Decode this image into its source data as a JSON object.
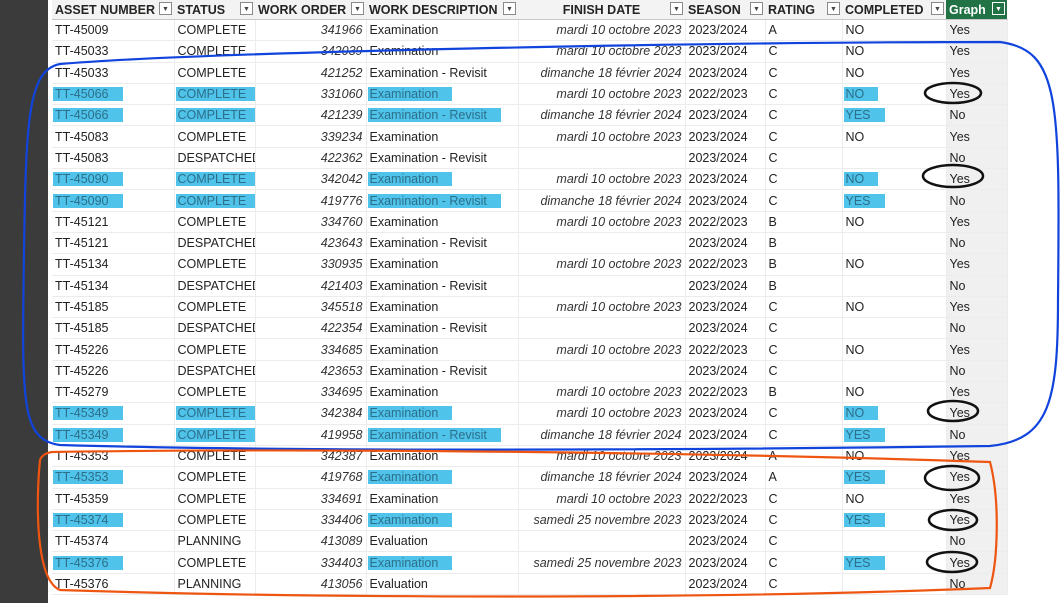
{
  "columns": [
    "ASSET NUMBER",
    "STATUS",
    "WORK ORDER",
    "WORK DESCRIPTION",
    "FINISH DATE",
    "SEASON",
    "RATING",
    "COMPLETED",
    "Graph"
  ],
  "rows": [
    [
      "TT-45009",
      "COMPLETE",
      "341966",
      "Examination",
      "mardi 10 octobre 2023",
      "2023/2024",
      "A",
      "NO",
      "Yes"
    ],
    [
      "TT-45033",
      "COMPLETE",
      "342039",
      "Examination",
      "mardi 10 octobre 2023",
      "2023/2024",
      "C",
      "NO",
      "Yes"
    ],
    [
      "TT-45033",
      "COMPLETE",
      "421252",
      "Examination - Revisit",
      "dimanche 18 février 2024",
      "2023/2024",
      "C",
      "NO",
      "Yes"
    ],
    [
      "TT-45066",
      "COMPLETE",
      "331060",
      "Examination",
      "mardi 10 octobre 2023",
      "2022/2023",
      "C",
      "NO",
      "Yes"
    ],
    [
      "TT-45066",
      "COMPLETE",
      "421239",
      "Examination - Revisit",
      "dimanche 18 février 2024",
      "2023/2024",
      "C",
      "YES",
      "No"
    ],
    [
      "TT-45083",
      "COMPLETE",
      "339234",
      "Examination",
      "mardi 10 octobre 2023",
      "2023/2024",
      "C",
      "NO",
      "Yes"
    ],
    [
      "TT-45083",
      "DESPATCHED",
      "422362",
      "Examination - Revisit",
      "",
      "2023/2024",
      "C",
      "",
      "No"
    ],
    [
      "TT-45090",
      "COMPLETE",
      "342042",
      "Examination",
      "mardi 10 octobre 2023",
      "2023/2024",
      "C",
      "NO",
      "Yes"
    ],
    [
      "TT-45090",
      "COMPLETE",
      "419776",
      "Examination - Revisit",
      "dimanche 18 février 2024",
      "2023/2024",
      "C",
      "YES",
      "No"
    ],
    [
      "TT-45121",
      "COMPLETE",
      "334760",
      "Examination",
      "mardi 10 octobre 2023",
      "2022/2023",
      "B",
      "NO",
      "Yes"
    ],
    [
      "TT-45121",
      "DESPATCHED",
      "423643",
      "Examination - Revisit",
      "",
      "2023/2024",
      "B",
      "",
      "No"
    ],
    [
      "TT-45134",
      "COMPLETE",
      "330935",
      "Examination",
      "mardi 10 octobre 2023",
      "2022/2023",
      "B",
      "NO",
      "Yes"
    ],
    [
      "TT-45134",
      "DESPATCHED",
      "421403",
      "Examination - Revisit",
      "",
      "2023/2024",
      "B",
      "",
      "No"
    ],
    [
      "TT-45185",
      "COMPLETE",
      "345518",
      "Examination",
      "mardi 10 octobre 2023",
      "2023/2024",
      "C",
      "NO",
      "Yes"
    ],
    [
      "TT-45185",
      "DESPATCHED",
      "422354",
      "Examination - Revisit",
      "",
      "2023/2024",
      "C",
      "",
      "No"
    ],
    [
      "TT-45226",
      "COMPLETE",
      "334685",
      "Examination",
      "mardi 10 octobre 2023",
      "2022/2023",
      "C",
      "NO",
      "Yes"
    ],
    [
      "TT-45226",
      "DESPATCHED",
      "423653",
      "Examination - Revisit",
      "",
      "2023/2024",
      "C",
      "",
      "No"
    ],
    [
      "TT-45279",
      "COMPLETE",
      "334695",
      "Examination",
      "mardi 10 octobre 2023",
      "2022/2023",
      "B",
      "NO",
      "Yes"
    ],
    [
      "TT-45349",
      "COMPLETE",
      "342384",
      "Examination",
      "mardi 10 octobre 2023",
      "2023/2024",
      "C",
      "NO",
      "Yes"
    ],
    [
      "TT-45349",
      "COMPLETE",
      "419958",
      "Examination - Revisit",
      "dimanche 18 février 2024",
      "2023/2024",
      "C",
      "YES",
      "No"
    ],
    [
      "TT-45353",
      "COMPLETE",
      "342387",
      "Examination",
      "mardi 10 octobre 2023",
      "2023/2024",
      "A",
      "NO",
      "Yes"
    ],
    [
      "TT-45353",
      "COMPLETE",
      "419768",
      "Examination",
      "dimanche 18 février 2024",
      "2023/2024",
      "A",
      "YES",
      "Yes"
    ],
    [
      "TT-45359",
      "COMPLETE",
      "334691",
      "Examination",
      "mardi 10 octobre 2023",
      "2022/2023",
      "C",
      "NO",
      "Yes"
    ],
    [
      "TT-45374",
      "COMPLETE",
      "334406",
      "Examination",
      "samedi 25 novembre 2023",
      "2023/2024",
      "C",
      "YES",
      "Yes"
    ],
    [
      "TT-45374",
      "PLANNING",
      "413089",
      "Evaluation",
      "",
      "2023/2024",
      "C",
      "",
      "No"
    ],
    [
      "TT-45376",
      "COMPLETE",
      "334403",
      "Examination",
      "samedi 25 novembre 2023",
      "2023/2024",
      "C",
      "YES",
      "Yes"
    ],
    [
      "TT-45376",
      "PLANNING",
      "413056",
      "Evaluation",
      "",
      "2023/2024",
      "C",
      "",
      "No"
    ]
  ],
  "highlight_rows": [
    3,
    4,
    7,
    8,
    18,
    19
  ],
  "highlight_rows_orange": [
    21,
    23,
    25
  ],
  "colors": {
    "highlight": "#4fc3ea",
    "graph_header": "#217346",
    "blue_outline": "#1144dd",
    "orange_outline": "#ee5511",
    "left_strip": "#3b3b3b"
  },
  "icons": {
    "column_filter": "chevron-down-icon"
  }
}
